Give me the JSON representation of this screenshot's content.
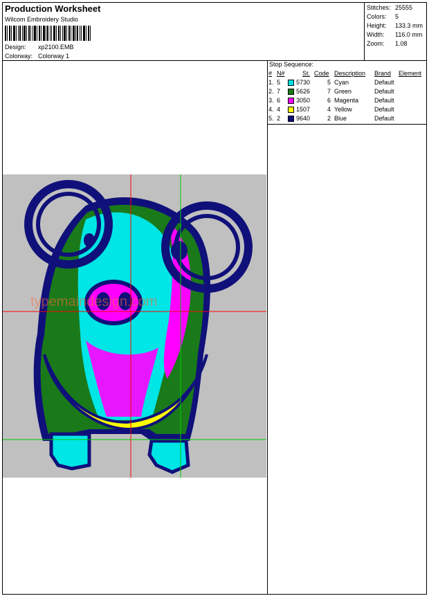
{
  "header": {
    "title": "Production Worksheet",
    "software": "Wilcom  Embroidery Studio",
    "design_label": "Design:",
    "design_value": "xp2100.EMB",
    "colorway_label": "Colorway:",
    "colorway_value": "Colorway 1"
  },
  "stats": {
    "stitches_label": "Stitches:",
    "stitches_value": "25555",
    "colors_label": "Colors:",
    "colors_value": "5",
    "height_label": "Height:",
    "height_value": "133.3 mm",
    "width_label": "Width:",
    "width_value": "116.0 mm",
    "zoom_label": "Zoom:",
    "zoom_value": "1.08"
  },
  "stop_sequence": {
    "title": "Stop Sequence:",
    "headers": {
      "stop": "#",
      "needle": "N#",
      "st": "St.",
      "code": "Code",
      "description": "Description",
      "brand": "Brand",
      "element": "Element"
    },
    "rows": [
      {
        "stop": "1.",
        "needle": "5",
        "color": "#00e5e5",
        "st": "5730",
        "code": "5",
        "description": "Cyan",
        "brand": "Default"
      },
      {
        "stop": "2.",
        "needle": "7",
        "color": "#1a7a1a",
        "st": "5626",
        "code": "7",
        "description": "Green",
        "brand": "Default"
      },
      {
        "stop": "3.",
        "needle": "6",
        "color": "#ff00ff",
        "st": "3050",
        "code": "6",
        "description": "Magenta",
        "brand": "Default"
      },
      {
        "stop": "4.",
        "needle": "4",
        "color": "#ffff00",
        "st": "1507",
        "code": "4",
        "description": "Yellow",
        "brand": "Default"
      },
      {
        "stop": "5.",
        "needle": "2",
        "color": "#10107a",
        "st": "9640",
        "code": "2",
        "description": "Blue",
        "brand": "Default"
      }
    ]
  },
  "preview": {
    "background_color": "#c0c0c0",
    "watermark": "typemaindesign.com",
    "marker_1": "1",
    "marker_2": "2"
  }
}
